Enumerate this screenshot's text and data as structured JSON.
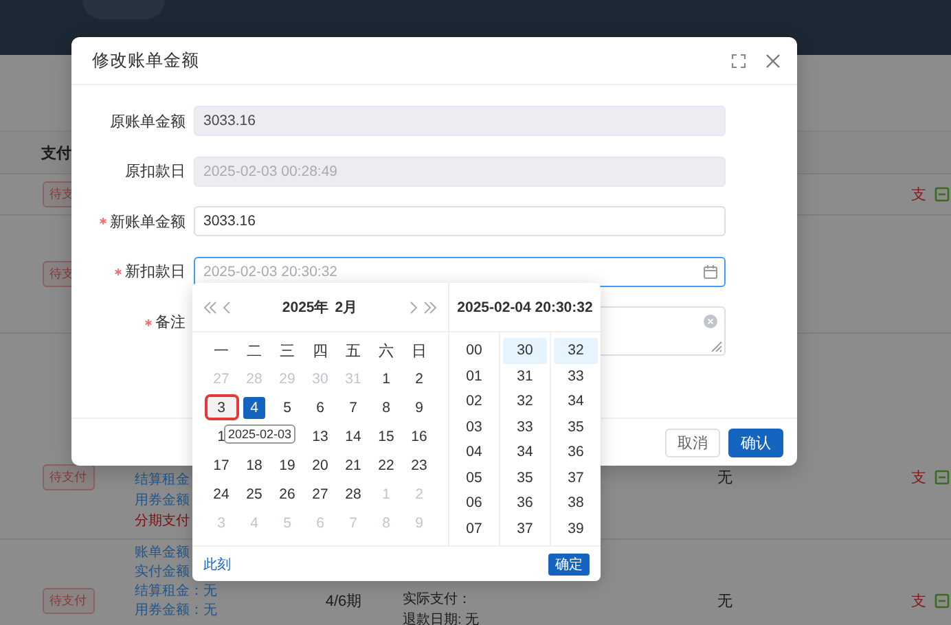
{
  "page": {
    "table_header": "支付",
    "rows": [
      {
        "tag": "待支",
        "action": "支"
      },
      {
        "tag": "待支"
      },
      {
        "tag": "待支付",
        "action": "支",
        "lines": [
          {
            "text": "结算租金",
            "kind": "normal"
          },
          {
            "text": "用券金额",
            "kind": "normal"
          },
          {
            "text": "分期支付",
            "kind": "alert"
          }
        ],
        "status": "无"
      },
      {
        "tag": "待支付",
        "action": "支",
        "lines": [
          {
            "text": "账单金额",
            "kind": "normal"
          },
          {
            "text": "实付金额",
            "kind": "normal"
          },
          {
            "text": "结算租金：无",
            "kind": "normal"
          },
          {
            "text": "用券金额：无",
            "kind": "normal"
          }
        ],
        "period": "4/6期",
        "details": [
          "实际支付：",
          "退款日期: 无"
        ],
        "status": "无"
      }
    ]
  },
  "dialog": {
    "title": "修改账单金额",
    "fields": [
      {
        "label": "原账单金额",
        "kind": "input",
        "disabled": true,
        "focused": false,
        "required": false,
        "value": "3033.16"
      },
      {
        "label": "原扣款日",
        "kind": "input",
        "disabled": true,
        "focused": false,
        "required": false,
        "placeholder": "2025-02-03 00:28:49"
      },
      {
        "label": "新账单金额",
        "kind": "input",
        "disabled": false,
        "focused": false,
        "required": true,
        "value": "3033.16"
      },
      {
        "label": "新扣款日",
        "kind": "date",
        "disabled": false,
        "focused": true,
        "required": true,
        "placeholder": "2025-02-03 20:30:32"
      },
      {
        "label": "备注",
        "kind": "textarea",
        "disabled": false,
        "focused": false,
        "required": true
      }
    ],
    "buttons": [
      {
        "label": "取消",
        "primary": false
      },
      {
        "label": "确认",
        "primary": true
      }
    ]
  },
  "picker": {
    "year": "2025年",
    "month": "2月",
    "datetime": "2025-02-04 20:30:32",
    "weekdays": [
      "一",
      "二",
      "三",
      "四",
      "五",
      "六",
      "日"
    ],
    "days": [
      {
        "kind": "day",
        "text": "27",
        "muted": true,
        "selected": false,
        "marked": false
      },
      {
        "kind": "day",
        "text": "28",
        "muted": true,
        "selected": false,
        "marked": false
      },
      {
        "kind": "day",
        "text": "29",
        "muted": true,
        "selected": false,
        "marked": false
      },
      {
        "kind": "day",
        "text": "30",
        "muted": true,
        "selected": false,
        "marked": false
      },
      {
        "kind": "day",
        "text": "31",
        "muted": true,
        "selected": false,
        "marked": false
      },
      {
        "kind": "day",
        "text": "1",
        "muted": false,
        "selected": false,
        "marked": false
      },
      {
        "kind": "day",
        "text": "2",
        "muted": false,
        "selected": false,
        "marked": false
      },
      {
        "kind": "day",
        "text": "3",
        "muted": false,
        "selected": false,
        "marked": true
      },
      {
        "kind": "day",
        "text": "4",
        "muted": false,
        "selected": true,
        "marked": false
      },
      {
        "kind": "day",
        "text": "5",
        "muted": false,
        "selected": false,
        "marked": false
      },
      {
        "kind": "day",
        "text": "6",
        "muted": false,
        "selected": false,
        "marked": false
      },
      {
        "kind": "day",
        "text": "7",
        "muted": false,
        "selected": false,
        "marked": false
      },
      {
        "kind": "day",
        "text": "8",
        "muted": false,
        "selected": false,
        "marked": false
      },
      {
        "kind": "day",
        "text": "9",
        "muted": false,
        "selected": false,
        "marked": false
      },
      {
        "kind": "day",
        "text": "1",
        "muted": false,
        "selected": false,
        "marked": false
      },
      {
        "kind": "covered"
      },
      {
        "kind": "covered"
      },
      {
        "kind": "day",
        "text": "13",
        "muted": false,
        "selected": false,
        "marked": false
      },
      {
        "kind": "day",
        "text": "14",
        "muted": false,
        "selected": false,
        "marked": false
      },
      {
        "kind": "day",
        "text": "15",
        "muted": false,
        "selected": false,
        "marked": false
      },
      {
        "kind": "day",
        "text": "16",
        "muted": false,
        "selected": false,
        "marked": false
      },
      {
        "kind": "day",
        "text": "17",
        "muted": false,
        "selected": false,
        "marked": false
      },
      {
        "kind": "day",
        "text": "18",
        "muted": false,
        "selected": false,
        "marked": false
      },
      {
        "kind": "day",
        "text": "19",
        "muted": false,
        "selected": false,
        "marked": false
      },
      {
        "kind": "day",
        "text": "20",
        "muted": false,
        "selected": false,
        "marked": false
      },
      {
        "kind": "day",
        "text": "21",
        "muted": false,
        "selected": false,
        "marked": false
      },
      {
        "kind": "day",
        "text": "22",
        "muted": false,
        "selected": false,
        "marked": false
      },
      {
        "kind": "day",
        "text": "23",
        "muted": false,
        "selected": false,
        "marked": false
      },
      {
        "kind": "day",
        "text": "24",
        "muted": false,
        "selected": false,
        "marked": false
      },
      {
        "kind": "day",
        "text": "25",
        "muted": false,
        "selected": false,
        "marked": false
      },
      {
        "kind": "day",
        "text": "26",
        "muted": false,
        "selected": false,
        "marked": false
      },
      {
        "kind": "day",
        "text": "27",
        "muted": false,
        "selected": false,
        "marked": false
      },
      {
        "kind": "day",
        "text": "28",
        "muted": false,
        "selected": false,
        "marked": false
      },
      {
        "kind": "day",
        "text": "1",
        "muted": true,
        "selected": false,
        "marked": false
      },
      {
        "kind": "day",
        "text": "2",
        "muted": true,
        "selected": false,
        "marked": false
      },
      {
        "kind": "day",
        "text": "3",
        "muted": true,
        "selected": false,
        "marked": false
      },
      {
        "kind": "day",
        "text": "4",
        "muted": true,
        "selected": false,
        "marked": false
      },
      {
        "kind": "day",
        "text": "5",
        "muted": true,
        "selected": false,
        "marked": false
      },
      {
        "kind": "day",
        "text": "6",
        "muted": true,
        "selected": false,
        "marked": false
      },
      {
        "kind": "day",
        "text": "7",
        "muted": true,
        "selected": false,
        "marked": false
      },
      {
        "kind": "day",
        "text": "8",
        "muted": true,
        "selected": false,
        "marked": false
      },
      {
        "kind": "day",
        "text": "9",
        "muted": true,
        "selected": false,
        "marked": false
      }
    ],
    "tooltip": "2025-02-03",
    "hours": [
      {
        "text": "00",
        "selected": false
      },
      {
        "text": "01",
        "selected": false
      },
      {
        "text": "02",
        "selected": false
      },
      {
        "text": "03",
        "selected": false
      },
      {
        "text": "04",
        "selected": false
      },
      {
        "text": "05",
        "selected": false
      },
      {
        "text": "06",
        "selected": false
      },
      {
        "text": "07",
        "selected": false
      }
    ],
    "minutes": [
      {
        "text": "30",
        "selected": true
      },
      {
        "text": "31",
        "selected": false
      },
      {
        "text": "32",
        "selected": false
      },
      {
        "text": "33",
        "selected": false
      },
      {
        "text": "34",
        "selected": false
      },
      {
        "text": "35",
        "selected": false
      },
      {
        "text": "36",
        "selected": false
      },
      {
        "text": "37",
        "selected": false
      }
    ],
    "seconds": [
      {
        "text": "32",
        "selected": true
      },
      {
        "text": "33",
        "selected": false
      },
      {
        "text": "34",
        "selected": false
      },
      {
        "text": "35",
        "selected": false
      },
      {
        "text": "36",
        "selected": false
      },
      {
        "text": "37",
        "selected": false
      },
      {
        "text": "38",
        "selected": false
      },
      {
        "text": "39",
        "selected": false
      }
    ],
    "now": "此刻",
    "ok": "确定"
  }
}
